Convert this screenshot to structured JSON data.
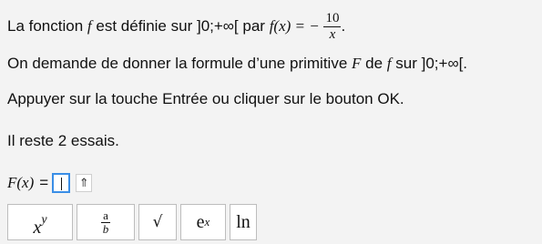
{
  "statement": {
    "intro": "La fonction",
    "f": "f",
    "middle": "est définie sur",
    "interval": "]0;+∞[",
    "par": "par",
    "func_lhs": "f(x) = −",
    "num": "10",
    "den": "x",
    "end": "."
  },
  "request": {
    "text": "On demande de donner la formule d’une primitive",
    "F": "F",
    "de": "de",
    "f": "f",
    "sur": "sur",
    "interval": "]0;+∞[."
  },
  "instruction": "Appuyer sur la touche Entrée ou cliquer sur le bouton OK.",
  "attempts": "Il reste 2 essais.",
  "answer": {
    "label": "F(x)",
    "eq": "=",
    "value": "",
    "shift_button": "⇑"
  },
  "keypad": {
    "power_base": "x",
    "power_exp": "y",
    "frac_num": "a",
    "frac_den": "b",
    "sqrt": "√",
    "exp_base": "e",
    "exp_power": "x",
    "ln": "ln"
  }
}
